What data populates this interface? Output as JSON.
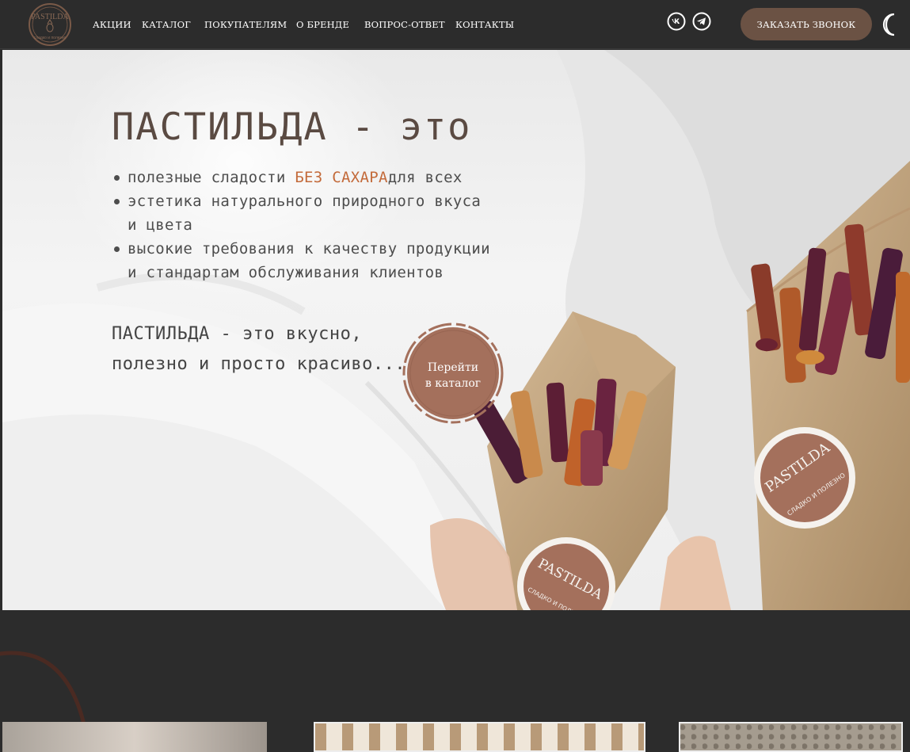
{
  "header": {
    "logo": {
      "text": "PASTILDA",
      "sub": "сладко и полезно",
      "icon": "pineapple-logo"
    },
    "nav": [
      "АКЦИИ",
      "КАТАЛОГ",
      "ПОКУПАТЕЛЯМ",
      "О БРЕНДЕ",
      "ВОПРОС-ОТВЕТ",
      "КОНТАКТЫ"
    ],
    "social": [
      {
        "name": "VK",
        "icon": "vk-icon"
      },
      {
        "name": "Telegram",
        "icon": "telegram-icon"
      }
    ],
    "callback_label": "ЗАКАЗАТЬ ЗВОНОК",
    "theme_icon": "moon-icon"
  },
  "hero": {
    "title": "ПАСТИЛЬДА - это",
    "benefits": {
      "b1_before": "полезные сладости ",
      "b1_accent": "БЕЗ САХАРА",
      "b1_after": "для всех",
      "b2": "эстетика натурального природного вкуса и цвета",
      "b3": "высокие требования к качеству продукции и стандартам обслуживания клиентов"
    },
    "tagline": "ПАСТИЛЬДА - это вкусно, полезно и просто красиво...",
    "catalog_button": "Перейти\nв каталог",
    "product_label_1": "PASTILDA",
    "product_sub_1": "СЛАДКО И ПОЛЕЗНО",
    "product_label_2": "PASTILDA",
    "product_sub_2": "СЛАДКО И ПОЛЕЗНО"
  },
  "colors": {
    "header_bg": "#2c2c2c",
    "accent_brown": "#6b5244",
    "button_terracotta": "#a4705c",
    "accent_orange": "#c36a3a"
  }
}
